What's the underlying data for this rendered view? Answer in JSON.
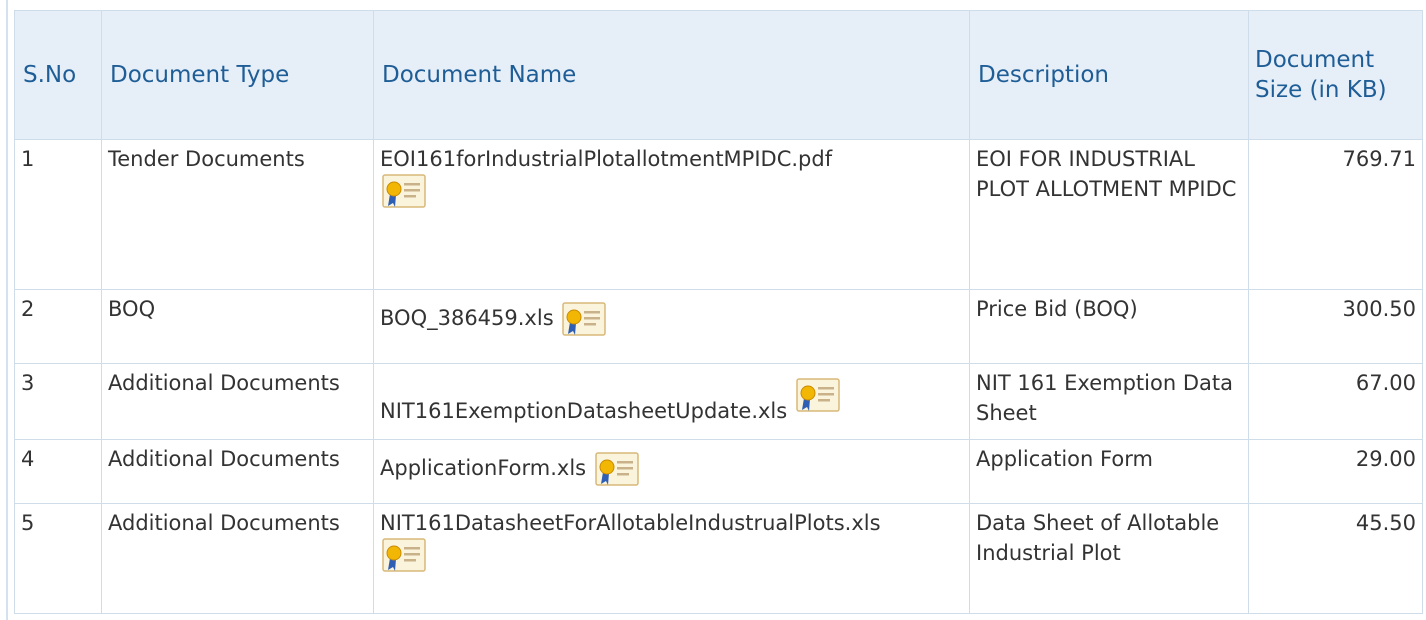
{
  "table": {
    "headers": {
      "sno": "S.No",
      "type": "Document Type",
      "name": "Document Name",
      "description": "Description",
      "size": "Document Size (in KB)"
    },
    "rows": [
      {
        "sno": "1",
        "type": "Tender Documents",
        "name": "EOI161forIndustrialPlotallotmentMPIDC.pdf",
        "description": "EOI FOR INDUSTRIAL PLOT ALLOTMENT MPIDC",
        "size": "769.71",
        "icon": "certificate-icon"
      },
      {
        "sno": "2",
        "type": "BOQ",
        "name": "BOQ_386459.xls",
        "description": "Price Bid (BOQ)",
        "size": "300.50",
        "icon": "certificate-icon"
      },
      {
        "sno": "3",
        "type": "Additional Documents",
        "name": "NIT161ExemptionDatasheetUpdate.xls",
        "description": "NIT 161 Exemption Data Sheet",
        "size": "67.00",
        "icon": "certificate-icon"
      },
      {
        "sno": "4",
        "type": "Additional Documents",
        "name": "ApplicationForm.xls",
        "description": "Application Form",
        "size": "29.00",
        "icon": "certificate-icon"
      },
      {
        "sno": "5",
        "type": "Additional Documents",
        "name": "NIT161DatasheetForAllotableIndustrualPlots.xls",
        "description": "Data Sheet of Allotable Industrial Plot",
        "size": "45.50",
        "icon": "certificate-icon"
      }
    ]
  },
  "colors": {
    "header_bg": "#e6eff8",
    "header_text": "#1f5d96",
    "border": "#cfdce9",
    "cell_text": "#333333"
  }
}
